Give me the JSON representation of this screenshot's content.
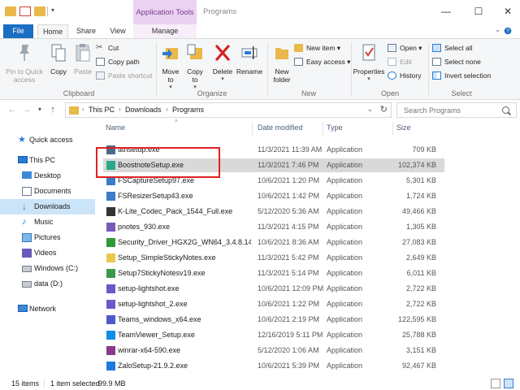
{
  "colors": {
    "accent": "#1a6ec4",
    "context_tab_bg": "#ead2f0",
    "context_tab_text": "#7b3b92",
    "selection": "#cce4f7",
    "annotation_box": "#e02020"
  },
  "titlebar": {
    "context_tab": "Application Tools",
    "title": "Programs",
    "minimize": "—",
    "maximize": "☐",
    "close": "✕"
  },
  "tabs": {
    "file": "File",
    "home": "Home",
    "share": "Share",
    "view": "View",
    "manage": "Manage"
  },
  "ribbon": {
    "clipboard": {
      "label": "Clipboard",
      "pin": "Pin to Quick access",
      "copy": "Copy",
      "paste": "Paste",
      "cut": "Cut",
      "copy_path": "Copy path",
      "paste_shortcut": "Paste shortcut"
    },
    "organize": {
      "label": "Organize",
      "move_to": "Move to",
      "copy_to": "Copy to",
      "delete": "Delete",
      "rename": "Rename"
    },
    "new": {
      "label": "New",
      "new_folder": "New folder",
      "new_item": "New item ▾",
      "easy_access": "Easy access ▾"
    },
    "open": {
      "label": "Open",
      "properties": "Properties",
      "open": "Open ▾",
      "edit": "Edit",
      "history": "History"
    },
    "select": {
      "label": "Select",
      "select_all": "Select all",
      "select_none": "Select none",
      "invert_selection": "Invert selection"
    }
  },
  "address": {
    "back": "←",
    "forward": "→",
    "recent": "▾",
    "up": "↑",
    "crumbs": [
      "This PC",
      "Downloads",
      "Programs"
    ],
    "search_placeholder": "Search Programs"
  },
  "nav": {
    "items": [
      {
        "label": "Quick access",
        "icon": "star-icon"
      },
      {
        "label": "This PC",
        "icon": "computer-icon"
      },
      {
        "label": "Desktop",
        "icon": "desktop-icon"
      },
      {
        "label": "Documents",
        "icon": "documents-icon"
      },
      {
        "label": "Downloads",
        "icon": "downloads-icon"
      },
      {
        "label": "Music",
        "icon": "music-icon"
      },
      {
        "label": "Pictures",
        "icon": "pictures-icon"
      },
      {
        "label": "Videos",
        "icon": "videos-icon"
      },
      {
        "label": "Windows (C:)",
        "icon": "drive-icon"
      },
      {
        "label": "data (D:)",
        "icon": "drive-icon"
      },
      {
        "label": "Network",
        "icon": "network-icon"
      }
    ]
  },
  "columns": {
    "name": "Name",
    "date": "Date modified",
    "type": "Type",
    "size": "Size"
  },
  "files": [
    {
      "name": "atnsetup.exe",
      "date": "11/3/2021 11:39 AM",
      "type": "Application",
      "size": "709 KB",
      "icon_color": "#4a6a8a"
    },
    {
      "name": "BoostnoteSetup.exe",
      "date": "11/3/2021 7:46 PM",
      "type": "Application",
      "size": "102,374 KB",
      "icon_color": "#2aa889"
    },
    {
      "name": "FSCaptureSetup97.exe",
      "date": "10/6/2021 1:20 PM",
      "type": "Application",
      "size": "5,301 KB",
      "icon_color": "#3b7bc8"
    },
    {
      "name": "FSResizerSetup43.exe",
      "date": "10/6/2021 1:42 PM",
      "type": "Application",
      "size": "1,724 KB",
      "icon_color": "#3b7bc8"
    },
    {
      "name": "K-Lite_Codec_Pack_1544_Full.exe",
      "date": "5/12/2020 5:36 AM",
      "type": "Application",
      "size": "49,466 KB",
      "icon_color": "#333333"
    },
    {
      "name": "pnotes_930.exe",
      "date": "11/3/2021 4:15 PM",
      "type": "Application",
      "size": "1,305 KB",
      "icon_color": "#7a5ab8"
    },
    {
      "name": "Security_Driver_HGX2G_WN64_3.4.8.14_A...",
      "date": "10/6/2021 8:36 AM",
      "type": "Application",
      "size": "27,083 KB",
      "icon_color": "#2f9a3a"
    },
    {
      "name": "Setup_SimpleStickyNotes.exe",
      "date": "11/3/2021 5:42 PM",
      "type": "Application",
      "size": "2,649 KB",
      "icon_color": "#e8c84a"
    },
    {
      "name": "Setup7StickyNotesv19.exe",
      "date": "11/3/2021 5:14 PM",
      "type": "Application",
      "size": "6,011 KB",
      "icon_color": "#3a9a4a"
    },
    {
      "name": "setup-lightshot.exe",
      "date": "10/6/2021 12:09 PM",
      "type": "Application",
      "size": "2,722 KB",
      "icon_color": "#6a5ac8"
    },
    {
      "name": "setup-lightshot_2.exe",
      "date": "10/6/2021 1:22 PM",
      "type": "Application",
      "size": "2,722 KB",
      "icon_color": "#6a5ac8"
    },
    {
      "name": "Teams_windows_x64.exe",
      "date": "10/6/2021 2:19 PM",
      "type": "Application",
      "size": "122,595 KB",
      "icon_color": "#5059c9"
    },
    {
      "name": "TeamViewer_Setup.exe",
      "date": "12/16/2019 5:11 PM",
      "type": "Application",
      "size": "25,788 KB",
      "icon_color": "#0e8ee9"
    },
    {
      "name": "winrar-x64-590.exe",
      "date": "5/12/2020 1:06 AM",
      "type": "Application",
      "size": "3,151 KB",
      "icon_color": "#8a3a8a"
    },
    {
      "name": "ZaloSetup-21.9.2.exe",
      "date": "10/6/2021 5:39 PM",
      "type": "Application",
      "size": "92,467 KB",
      "icon_color": "#1a7ae0"
    }
  ],
  "status": {
    "count": "15 items",
    "selection": "1 item selected",
    "size": "99.9 MB"
  }
}
